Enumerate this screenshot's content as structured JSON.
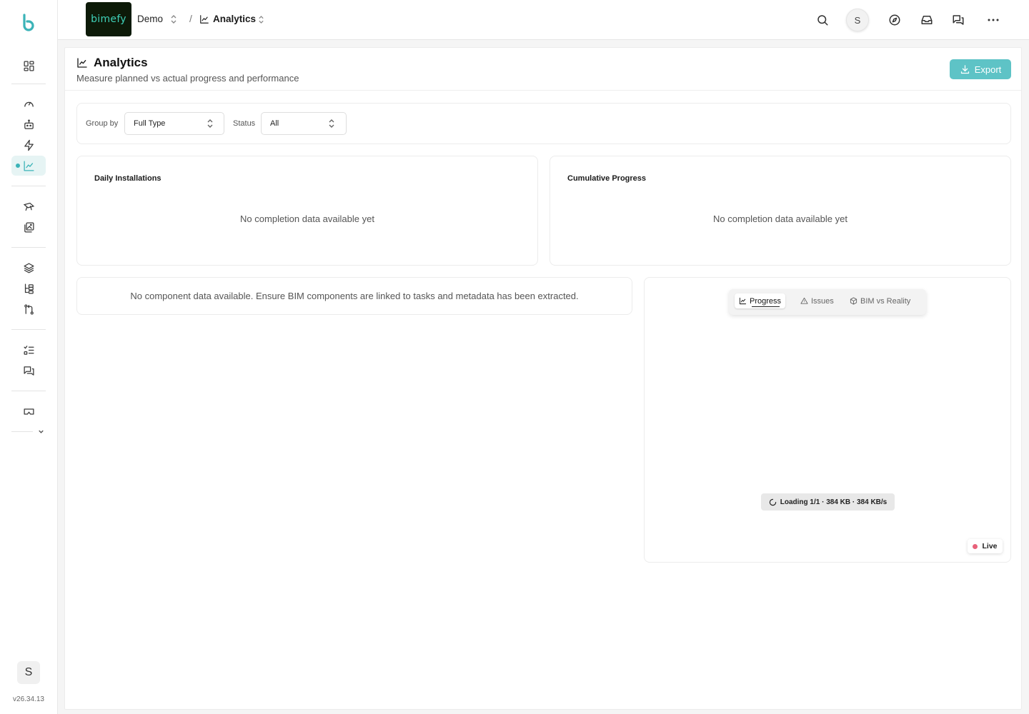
{
  "app": {
    "logo_letter": "b",
    "version": "v26.34.13",
    "user_initial": "S"
  },
  "colors": {
    "accent": "#3bb3b8",
    "export_button": "#5ec3c6",
    "live_dot": "#e8617a",
    "project_logo_bg": "#0d1a08"
  },
  "sidebar": {
    "items": [
      {
        "icon": "dashboard-grid-icon"
      },
      {
        "icon": "gauge-icon"
      },
      {
        "icon": "robot-icon"
      },
      {
        "icon": "lightning-icon"
      },
      {
        "icon": "chart-line-icon",
        "active": true
      },
      {
        "icon": "drone-icon"
      },
      {
        "icon": "images-icon"
      },
      {
        "icon": "layers-icon"
      },
      {
        "icon": "tree-structure-icon"
      },
      {
        "icon": "git-compare-icon"
      },
      {
        "icon": "checklist-icon"
      },
      {
        "icon": "messages-icon"
      },
      {
        "icon": "vr-headset-icon"
      },
      {
        "icon": "chevron-down-icon"
      }
    ]
  },
  "header": {
    "project_logo_text": "bimefy",
    "project_name": "Demo",
    "separator": "/",
    "breadcrumb": "Analytics",
    "avatar_initial": "S",
    "icons": [
      "search-icon",
      "compass-icon",
      "inbox-icon",
      "chat-icon",
      "more-icon"
    ]
  },
  "page": {
    "title": "Analytics",
    "subtitle": "Measure planned vs actual progress and performance",
    "export_label": "Export"
  },
  "filters": {
    "group_by_label": "Group by",
    "group_by_value": "Full Type",
    "status_label": "Status",
    "status_value": "All"
  },
  "charts": {
    "daily_title": "Daily Installations",
    "daily_empty": "No completion data available yet",
    "cumulative_title": "Cumulative Progress",
    "cumulative_empty": "No completion data available yet"
  },
  "components": {
    "empty": "No component data available. Ensure BIM components are linked to tasks and metadata has been extracted."
  },
  "viewer": {
    "tabs": [
      {
        "label": "Progress",
        "icon": "chart-line-icon",
        "active": true
      },
      {
        "label": "Issues",
        "icon": "warning-icon"
      },
      {
        "label": "BIM vs Reality",
        "icon": "cube-icon"
      }
    ],
    "loading_text": "Loading 1/1 · 384 KB · 384 KB/s",
    "live_label": "Live"
  }
}
